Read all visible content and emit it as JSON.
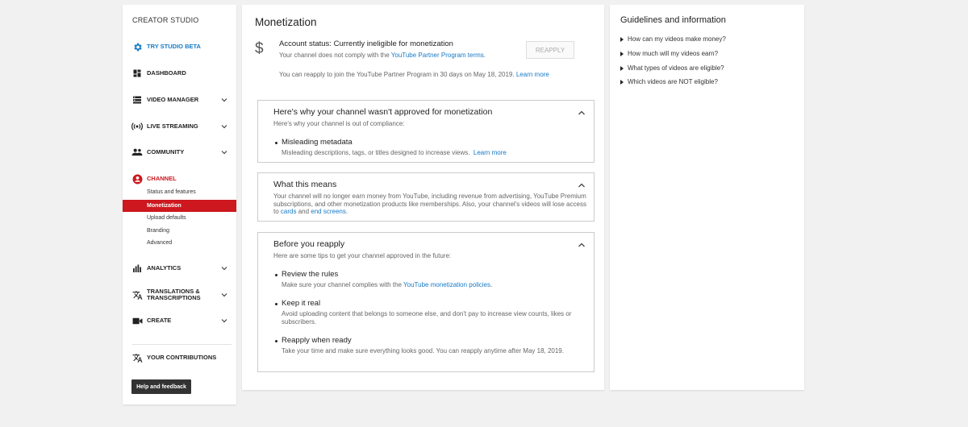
{
  "sidebar": {
    "title": "CREATOR STUDIO",
    "items": [
      {
        "label": "TRY STUDIO BETA",
        "icon": "gear-icon"
      },
      {
        "label": "DASHBOARD",
        "icon": "dashboard-icon"
      },
      {
        "label": "VIDEO MANAGER",
        "icon": "video-manager-icon"
      },
      {
        "label": "LIVE STREAMING",
        "icon": "live-streaming-icon"
      },
      {
        "label": "COMMUNITY",
        "icon": "community-icon"
      },
      {
        "label": "CHANNEL",
        "icon": "channel-icon"
      },
      {
        "label": "ANALYTICS",
        "icon": "analytics-icon"
      },
      {
        "label": "TRANSLATIONS &",
        "label2": "TRANSCRIPTIONS",
        "icon": "translate-icon"
      },
      {
        "label": "CREATE",
        "icon": "create-icon"
      },
      {
        "label": "YOUR CONTRIBUTIONS",
        "icon": "contributions-icon"
      }
    ],
    "channel_sub": [
      "Status and features",
      "Monetization",
      "Upload defaults",
      "Branding",
      "Advanced"
    ],
    "help_label": "Help and feedback"
  },
  "main": {
    "title": "Monetization",
    "status": "Account status: Currently ineligible for monetization",
    "status_sub_prefix": "Your channel does not comply with the ",
    "status_sub_link": "YouTube Partner Program terms",
    "status_sub_suffix": ".",
    "reapply_label": "REAPPLY",
    "reapply_note": "You can reapply to join the YouTube Partner Program in 30 days on May 18, 2019.",
    "learn_more": "Learn more",
    "why": {
      "heading": "Here's why your channel wasn't approved for monetization",
      "sub": "Here's why your channel is out of compliance:",
      "bullet_title": "Misleading metadata",
      "bullet_desc": "Misleading descriptions, tags, or titles designed to increase views.",
      "bullet_link": "Learn more"
    },
    "means": {
      "heading": "What this means",
      "text": "Your channel will no longer earn money from YouTube, including revenue from advertising, YouTube Premium subscriptions, and other monetization products like memberships. Also, your channel's videos will lose access to ",
      "link1": "cards",
      "and": " and ",
      "link2": "end screens",
      "end": "."
    },
    "before": {
      "heading": "Before you reapply",
      "sub": "Here are some tips to get your channel approved in the future:",
      "tips": [
        {
          "title": "Review the rules",
          "desc": "Make sure your channel complies with the ",
          "link": "YouTube monetization policies",
          "end": "."
        },
        {
          "title": "Keep it real",
          "desc": "Avoid uploading content that belongs to someone else, and don't pay to increase view counts, likes or subscribers."
        },
        {
          "title": "Reapply when ready",
          "desc": "Take your time and make sure everything looks good. You can reapply anytime after May 18, 2019."
        }
      ]
    }
  },
  "guidelines": {
    "title": "Guidelines and information",
    "items": [
      "How can my videos make money?",
      "How much will my videos earn?",
      "What types of videos are eligible?",
      "Which videos are NOT eligible?"
    ]
  },
  "colors": {
    "accent": "#167ac6",
    "active": "#cc181e"
  }
}
